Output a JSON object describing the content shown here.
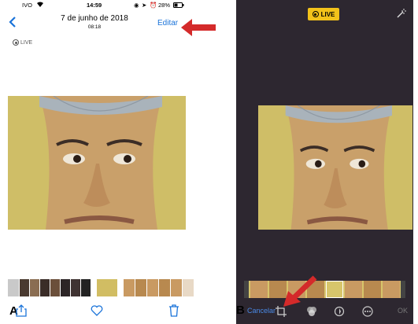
{
  "left": {
    "status": {
      "carrier": "IVO",
      "time": "14:59",
      "battery": "28%"
    },
    "nav": {
      "title": "7 de junho de 2018",
      "subtitle": "08:18",
      "edit_label": "Editar",
      "back_icon": "chevron-left-icon"
    },
    "live_label": "LIVE",
    "toolbar_icons": [
      "share-icon",
      "heart-icon",
      "trash-icon"
    ]
  },
  "right": {
    "live_label": "LIVE",
    "toolbar": {
      "cancel_label": "Cancelar",
      "ok_label": "OK",
      "icons": [
        "crop-icon",
        "filters-icon",
        "adjust-icon",
        "more-icon"
      ]
    }
  },
  "colors": {
    "accent_blue": "#1a73d9",
    "live_yellow": "#f2c21a",
    "arrow_red": "#d42a2a",
    "edit_bg": "#2d2730"
  },
  "annotation_letters": {
    "a": "A",
    "b": "B"
  }
}
